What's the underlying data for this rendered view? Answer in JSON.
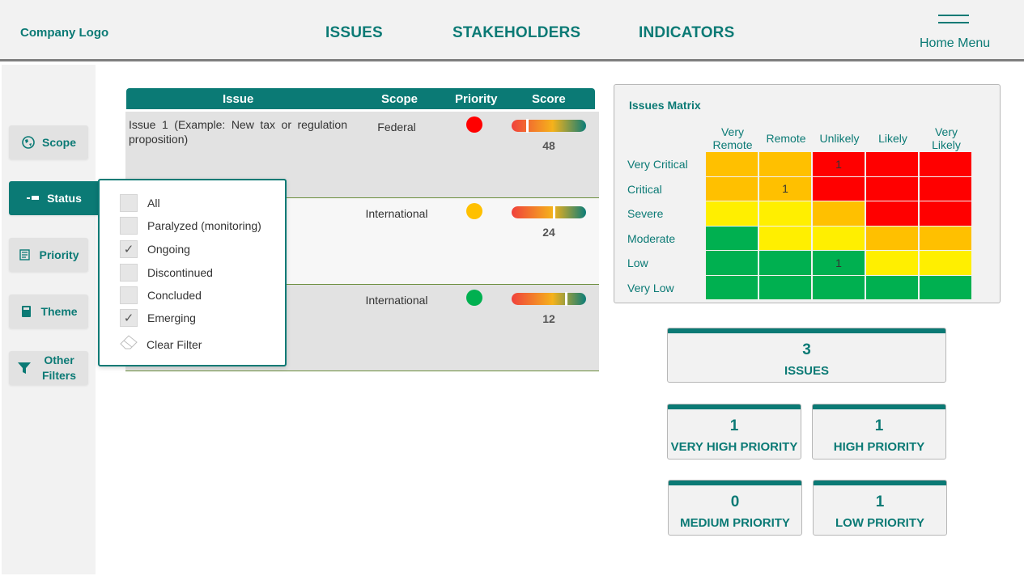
{
  "header": {
    "logo": "Company Logo",
    "nav": [
      "ISSUES",
      "STAKEHOLDERS",
      "INDICATORS"
    ],
    "home_menu": "Home Menu"
  },
  "sidebar": {
    "items": [
      {
        "label": "Scope",
        "icon": "globe-icon",
        "active": false
      },
      {
        "label": "Status",
        "icon": "status-icon",
        "active": true
      },
      {
        "label": "Priority",
        "icon": "priority-icon",
        "active": false
      },
      {
        "label": "Theme",
        "icon": "book-icon",
        "active": false
      },
      {
        "label": "Other Filters",
        "icon": "funnel-icon",
        "active": false
      }
    ]
  },
  "table": {
    "headers": [
      "Issue",
      "Scope",
      "Priority",
      "Score"
    ],
    "rows": [
      {
        "issue": "Issue 1 (Example: New tax or regulation proposition)",
        "scope": "Federal",
        "priority_color": "#ff0000",
        "score": "48",
        "score_fraction": 0.2
      },
      {
        "issue": "",
        "scope": "International",
        "priority_color": "#ffc000",
        "score": "24",
        "score_fraction": 0.55
      },
      {
        "issue": "",
        "scope": "International",
        "priority_color": "#00b050",
        "score": "12",
        "score_fraction": 0.72
      }
    ]
  },
  "status_filter": {
    "options": [
      {
        "label": "All",
        "checked": false
      },
      {
        "label": "Paralyzed (monitoring)",
        "checked": false
      },
      {
        "label": "Ongoing",
        "checked": true
      },
      {
        "label": "Discontinued",
        "checked": false
      },
      {
        "label": "Concluded",
        "checked": false
      },
      {
        "label": "Emerging",
        "checked": true
      }
    ],
    "clear_label": "Clear Filter"
  },
  "matrix": {
    "title": "Issues Matrix",
    "columns": [
      "Very\nRemote",
      "Remote",
      "Unlikely",
      "Likely",
      "Very\nLikely"
    ],
    "rows": [
      "Very Critical",
      "Critical",
      "Severe",
      "Moderate",
      "Low",
      "Very Low"
    ],
    "cells": [
      [
        {
          "c": "#ffc000",
          "v": ""
        },
        {
          "c": "#ffc000",
          "v": ""
        },
        {
          "c": "#ff0000",
          "v": "1"
        },
        {
          "c": "#ff0000",
          "v": ""
        },
        {
          "c": "#ff0000",
          "v": ""
        }
      ],
      [
        {
          "c": "#ffc000",
          "v": ""
        },
        {
          "c": "#ffc000",
          "v": "1"
        },
        {
          "c": "#ff0000",
          "v": ""
        },
        {
          "c": "#ff0000",
          "v": ""
        },
        {
          "c": "#ff0000",
          "v": ""
        }
      ],
      [
        {
          "c": "#ffef00",
          "v": ""
        },
        {
          "c": "#ffef00",
          "v": ""
        },
        {
          "c": "#ffc000",
          "v": ""
        },
        {
          "c": "#ff0000",
          "v": ""
        },
        {
          "c": "#ff0000",
          "v": ""
        }
      ],
      [
        {
          "c": "#00b050",
          "v": ""
        },
        {
          "c": "#ffef00",
          "v": ""
        },
        {
          "c": "#ffef00",
          "v": ""
        },
        {
          "c": "#ffc000",
          "v": ""
        },
        {
          "c": "#ffc000",
          "v": ""
        }
      ],
      [
        {
          "c": "#00b050",
          "v": ""
        },
        {
          "c": "#00b050",
          "v": ""
        },
        {
          "c": "#00b050",
          "v": "1"
        },
        {
          "c": "#ffef00",
          "v": ""
        },
        {
          "c": "#ffef00",
          "v": ""
        }
      ],
      [
        {
          "c": "#00b050",
          "v": ""
        },
        {
          "c": "#00b050",
          "v": ""
        },
        {
          "c": "#00b050",
          "v": ""
        },
        {
          "c": "#00b050",
          "v": ""
        },
        {
          "c": "#00b050",
          "v": ""
        }
      ]
    ]
  },
  "kpis": {
    "issues": {
      "value": "3",
      "label": "ISSUES"
    },
    "very_high": {
      "value": "1",
      "label": "VERY HIGH PRIORITY"
    },
    "high": {
      "value": "1",
      "label": "HIGH PRIORITY"
    },
    "medium": {
      "value": "0",
      "label": "MEDIUM PRIORITY"
    },
    "low": {
      "value": "1",
      "label": "LOW PRIORITY"
    }
  },
  "colors": {
    "accent": "#0b7a75"
  }
}
